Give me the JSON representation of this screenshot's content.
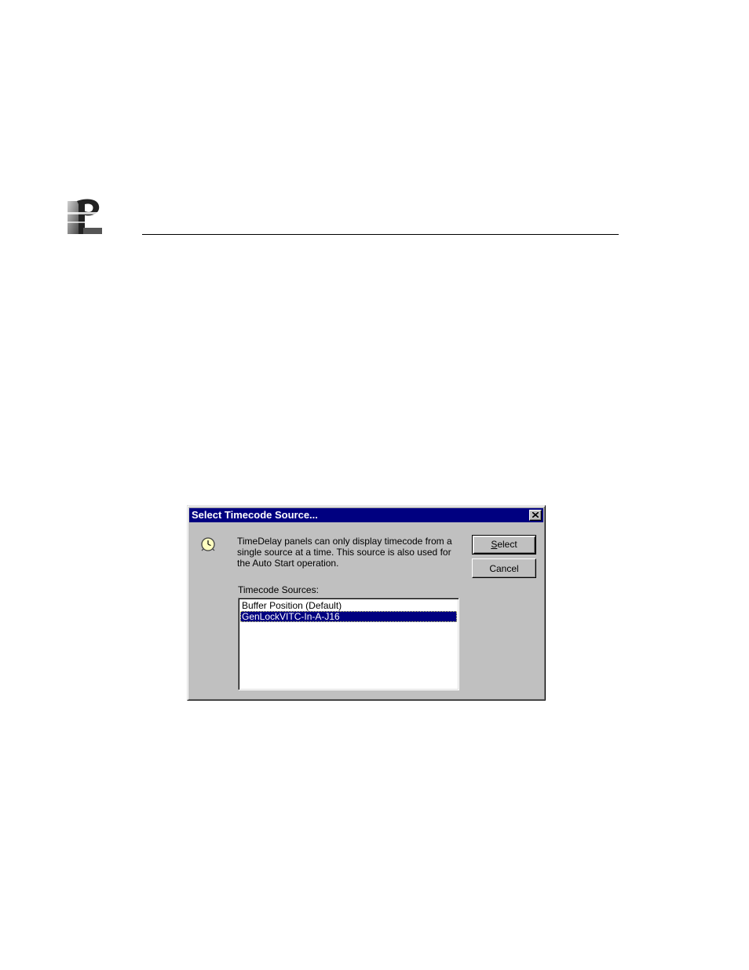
{
  "dialog": {
    "title": "Select Timecode Source...",
    "message": "TimeDelay panels can only display timecode from a single source at a time. This source is also used for the Auto Start operation.",
    "buttons": {
      "select_label": "Select",
      "select_mnemonic": "S",
      "select_rest": "elect",
      "cancel_label": "Cancel"
    },
    "sources_label": "Timecode Sources:",
    "sources": [
      {
        "label": "Buffer Position (Default)",
        "selected": false
      },
      {
        "label": "GenLockVITC-In-A-J16",
        "selected": true
      }
    ]
  },
  "colors": {
    "titlebar": "#000080",
    "dialog_face": "#c0c0c0",
    "selection": "#000080"
  },
  "icons": {
    "logo": "company-logo",
    "clock": "clock-icon",
    "close": "close-icon"
  }
}
